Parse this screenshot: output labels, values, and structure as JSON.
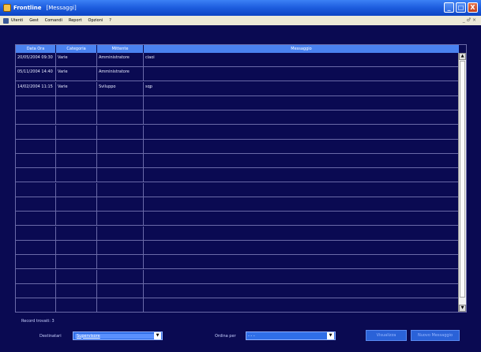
{
  "window": {
    "title": "Frontline",
    "subtitle": "[Messaggi]",
    "buttons": [
      "_",
      "□",
      "X"
    ]
  },
  "menu": {
    "items": [
      "Utenti",
      "Gest",
      "Comandi",
      "Report",
      "Opzioni",
      "?"
    ],
    "right": "_ ♂ ×"
  },
  "table": {
    "columns": [
      "Data Ora",
      "Categoria",
      "Mittente",
      "Messaggio"
    ],
    "rows": [
      {
        "date": "20/05/2004 09:30",
        "category": "Varie",
        "sender": "Amministratore",
        "message": "ciaoi"
      },
      {
        "date": "05/11/2004 14:40",
        "category": "Varie",
        "sender": "Amministratore",
        "message": ""
      },
      {
        "date": "14/02/2004 11:15",
        "category": "Varie",
        "sender": "Sviluppo",
        "message": "sqp"
      },
      {
        "date": "",
        "category": "",
        "sender": "",
        "message": ""
      },
      {
        "date": "",
        "category": "",
        "sender": "",
        "message": ""
      },
      {
        "date": "",
        "category": "",
        "sender": "",
        "message": ""
      },
      {
        "date": "",
        "category": "",
        "sender": "",
        "message": ""
      },
      {
        "date": "",
        "category": "",
        "sender": "",
        "message": ""
      },
      {
        "date": "",
        "category": "",
        "sender": "",
        "message": ""
      },
      {
        "date": "",
        "category": "",
        "sender": "",
        "message": ""
      },
      {
        "date": "",
        "category": "",
        "sender": "",
        "message": ""
      },
      {
        "date": "",
        "category": "",
        "sender": "",
        "message": ""
      },
      {
        "date": "",
        "category": "",
        "sender": "",
        "message": ""
      },
      {
        "date": "",
        "category": "",
        "sender": "",
        "message": ""
      },
      {
        "date": "",
        "category": "",
        "sender": "",
        "message": ""
      },
      {
        "date": "",
        "category": "",
        "sender": "",
        "message": ""
      },
      {
        "date": "",
        "category": "",
        "sender": "",
        "message": ""
      },
      {
        "date": "",
        "category": "",
        "sender": "",
        "message": ""
      }
    ]
  },
  "footer": {
    "record_count": "Record trovati: 3",
    "destinatari_label": "Destinatari",
    "destinatari_value": "Supervisore",
    "ordina_label": "Ordina per",
    "ordina_value": "- - -",
    "btn_visualizza": "Visualizza",
    "btn_nuovo": "Nuovo Messaggio"
  },
  "colors": {
    "background": "#0a0a52",
    "header": "#4a82f0",
    "titlebar": "#1f5fe0"
  }
}
